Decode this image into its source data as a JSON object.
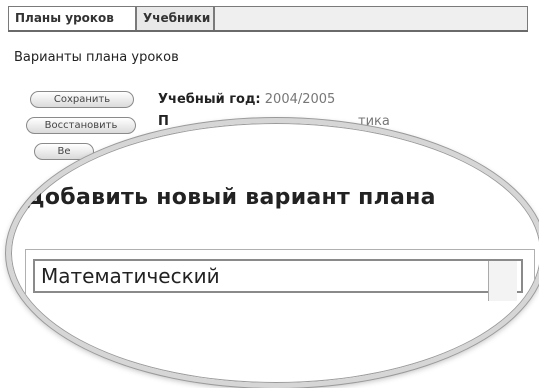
{
  "tabs": [
    {
      "label": "Планы уроков",
      "active": true
    },
    {
      "label": "Учебники",
      "active": false
    }
  ],
  "section_title": "Варианты плана уроков",
  "buttons": {
    "save": "Сохранить",
    "restore": "Восстановить",
    "third": "Ве"
  },
  "fields": {
    "year_label": "Учебный год:",
    "year_value": "2004/2005",
    "second_label_partial": "П",
    "second_value_partial": "тика"
  },
  "lens": {
    "heading": "Добавить новый вариант плана",
    "input_value": "Математический"
  },
  "colors": {
    "tab_border": "#7a7a7a",
    "lens_rim": "#d6d6d6"
  }
}
